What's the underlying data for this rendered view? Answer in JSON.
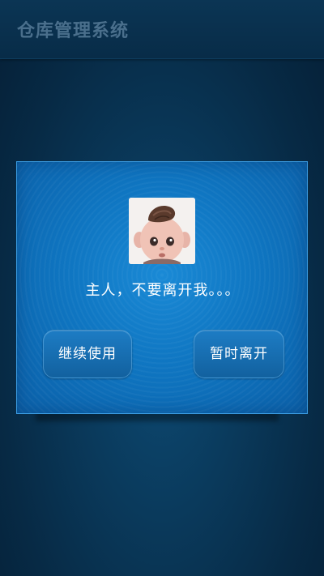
{
  "header": {
    "title": "仓库管理系统"
  },
  "dialog": {
    "avatar_icon": "cartoon-baby-avatar",
    "message": "主人，不要离开我。。。",
    "continue_label": "继续使用",
    "leave_label": "暂时离开"
  },
  "colors": {
    "background": "#072a45",
    "header": "#0b3554",
    "header_text": "#4a6f8c",
    "dialog": "#0f76c2",
    "dialog_border": "#3a9adf",
    "button": "#1a6fb3",
    "text": "#ffffff"
  }
}
